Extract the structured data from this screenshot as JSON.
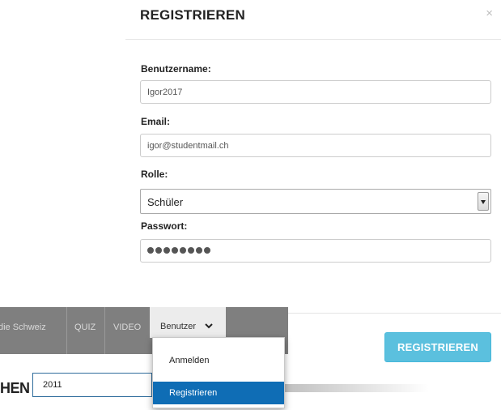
{
  "modal": {
    "title": "REGISTRIEREN",
    "close_glyph": "×",
    "fields": {
      "username": {
        "label": "Benutzername:",
        "value": "Igor2017"
      },
      "email": {
        "label": "Email:",
        "value": "igor@studentmail.ch"
      },
      "role": {
        "label": "Rolle:",
        "value": "Schüler"
      },
      "password": {
        "label": "Passwort:",
        "masked_length": 8
      }
    },
    "submit_label": "REGISTRIEREN",
    "submit_color": "#5bc0de"
  },
  "navbar": {
    "items": [
      "die Schweiz",
      "QUIZ",
      "VIDEO"
    ],
    "benutzer_label": "Benutzer",
    "dropdown": {
      "items": [
        "Anmelden",
        "Registrieren"
      ],
      "active_index": 1,
      "active_color": "#0f6db5"
    }
  },
  "page": {
    "partial_heading": "HEN",
    "year_value": "2011"
  }
}
